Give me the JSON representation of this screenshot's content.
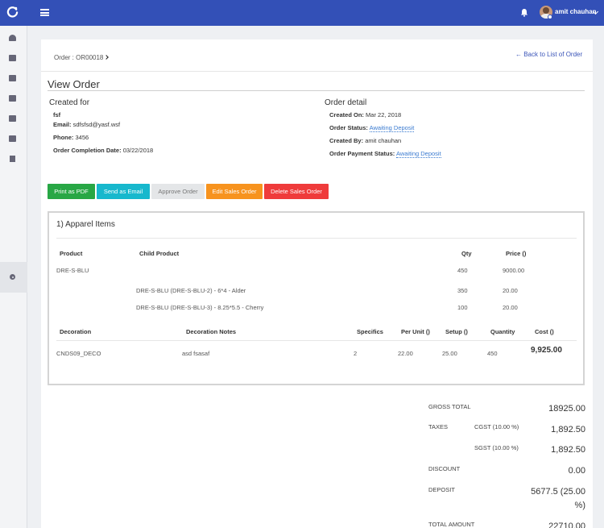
{
  "topbar": {
    "username": "amit chauhan"
  },
  "breadcrumb": {
    "order_label": "Order : OR00018"
  },
  "back_link": "← Back to List of Order",
  "page_title": "View Order",
  "created_for": {
    "title": "Created for",
    "name": "fsf",
    "email_label": "Email:",
    "email": "sdfsfsd@yasf.wsf",
    "phone_label": "Phone:",
    "phone": "3456",
    "completion_label": "Order Completion Date:",
    "completion_date": "03/22/2018"
  },
  "order_detail": {
    "title": "Order detail",
    "created_on_label": "Created On:",
    "created_on": "Mar 22, 2018",
    "status_label": "Order Status:",
    "status": "Awaiting Deposit",
    "created_by_label": "Created By:",
    "created_by": "amit chauhan",
    "payment_status_label": "Order Payment Status:",
    "payment_status": "Awaiting Deposit"
  },
  "buttons": {
    "print_pdf": "Print as PDF",
    "send_email": "Send as Email",
    "approve": "Approve Order",
    "edit": "Edit Sales Order",
    "delete": "Delete Sales Order"
  },
  "button_colors": {
    "print_pdf": "#28a745",
    "send_email": "#17b8cd",
    "approve": "#e4e6e8",
    "edit": "#f7931e",
    "delete": "#ef3b3b"
  },
  "items": {
    "section_title": "1) Apparel Items",
    "headers": {
      "product": "Product",
      "child_product": "Child Product",
      "qty": "Qty",
      "price": "Price ()"
    },
    "product_row": {
      "product": "DRE-S-BLU",
      "qty": "450",
      "price": "9000.00"
    },
    "child_rows": [
      {
        "child": "DRE-S-BLU (DRE-S-BLU-2) - 6*4 - Alder",
        "qty": "350",
        "price": "20.00"
      },
      {
        "child": "DRE-S-BLU (DRE-S-BLU-3) - 8.25*5.5 - Cherry",
        "qty": "100",
        "price": "20.00"
      }
    ],
    "decoration_headers": {
      "decoration": "Decoration",
      "notes": "Decoration Notes",
      "specifics": "Specifics",
      "per_unit": "Per Unit ()",
      "setup": "Setup ()",
      "quantity": "Quantity",
      "cost": "Cost ()"
    },
    "decoration_row": {
      "decoration": "CNDS09_DECO",
      "notes": "asd fsasaf",
      "specifics": "2",
      "per_unit": "22.00",
      "setup": "25.00",
      "quantity": "450",
      "cost": "9,925.00"
    }
  },
  "totals": {
    "gross_label": "GROSS TOTAL",
    "gross_value": "18925.00",
    "taxes_label": "TAXES",
    "cgst_label": "CGST (10.00 %)",
    "cgst_value": "1,892.50",
    "sgst_label": "SGST (10.00 %)",
    "sgst_value": "1,892.50",
    "discount_label": "DISCOUNT",
    "discount_value": "0.00",
    "deposit_label": "DEPOSIT",
    "deposit_value_line1": "5677.5 (25.00",
    "deposit_value_line2": "%)",
    "total_label": "TOTAL AMOUNT",
    "total_value": "22710.00"
  },
  "sidebar": {
    "icons": [
      "dashboard-icon",
      "grid-icon",
      "grid-icon",
      "grid-icon",
      "grid-icon",
      "grid-icon",
      "document-icon"
    ],
    "active_icon": "gear-icon"
  }
}
